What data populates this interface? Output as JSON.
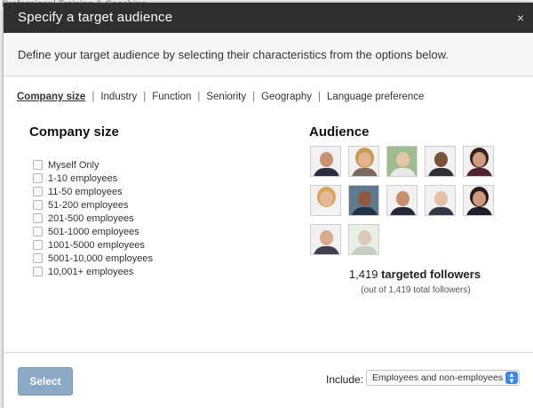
{
  "background": {
    "text": "Professional Training & Coaching"
  },
  "modal": {
    "title": "Specify a target audience",
    "close_label": "×",
    "description": "Define your target audience by selecting their characteristics from the options below."
  },
  "tabs": [
    {
      "label": "Company size",
      "active": true
    },
    {
      "label": "Industry"
    },
    {
      "label": "Function"
    },
    {
      "label": "Seniority"
    },
    {
      "label": "Geography"
    },
    {
      "label": "Language preference"
    }
  ],
  "company_size": {
    "heading": "Company size",
    "options": [
      "Myself Only",
      "1-10 employees",
      "11-50 employees",
      "51-200 employees",
      "201-500 employees",
      "501-1000 employees",
      "1001-5000 employees",
      "5001-10,000 employees",
      "10,001+ employees"
    ]
  },
  "audience": {
    "heading": "Audience",
    "targeted_count": "1,419",
    "targeted_label": "targeted followers",
    "total_note": "(out of 1,419 total followers)",
    "avatar_count": 12
  },
  "footer": {
    "select_label": "Select",
    "include_label": "Include:",
    "include_value": "Employees and non-employees",
    "chevron": "▲\n▼"
  },
  "colors": {
    "titlebar": "#2f2f2f",
    "select_button": "#8aa9c6",
    "dropdown_accent": "#3b88e8"
  }
}
